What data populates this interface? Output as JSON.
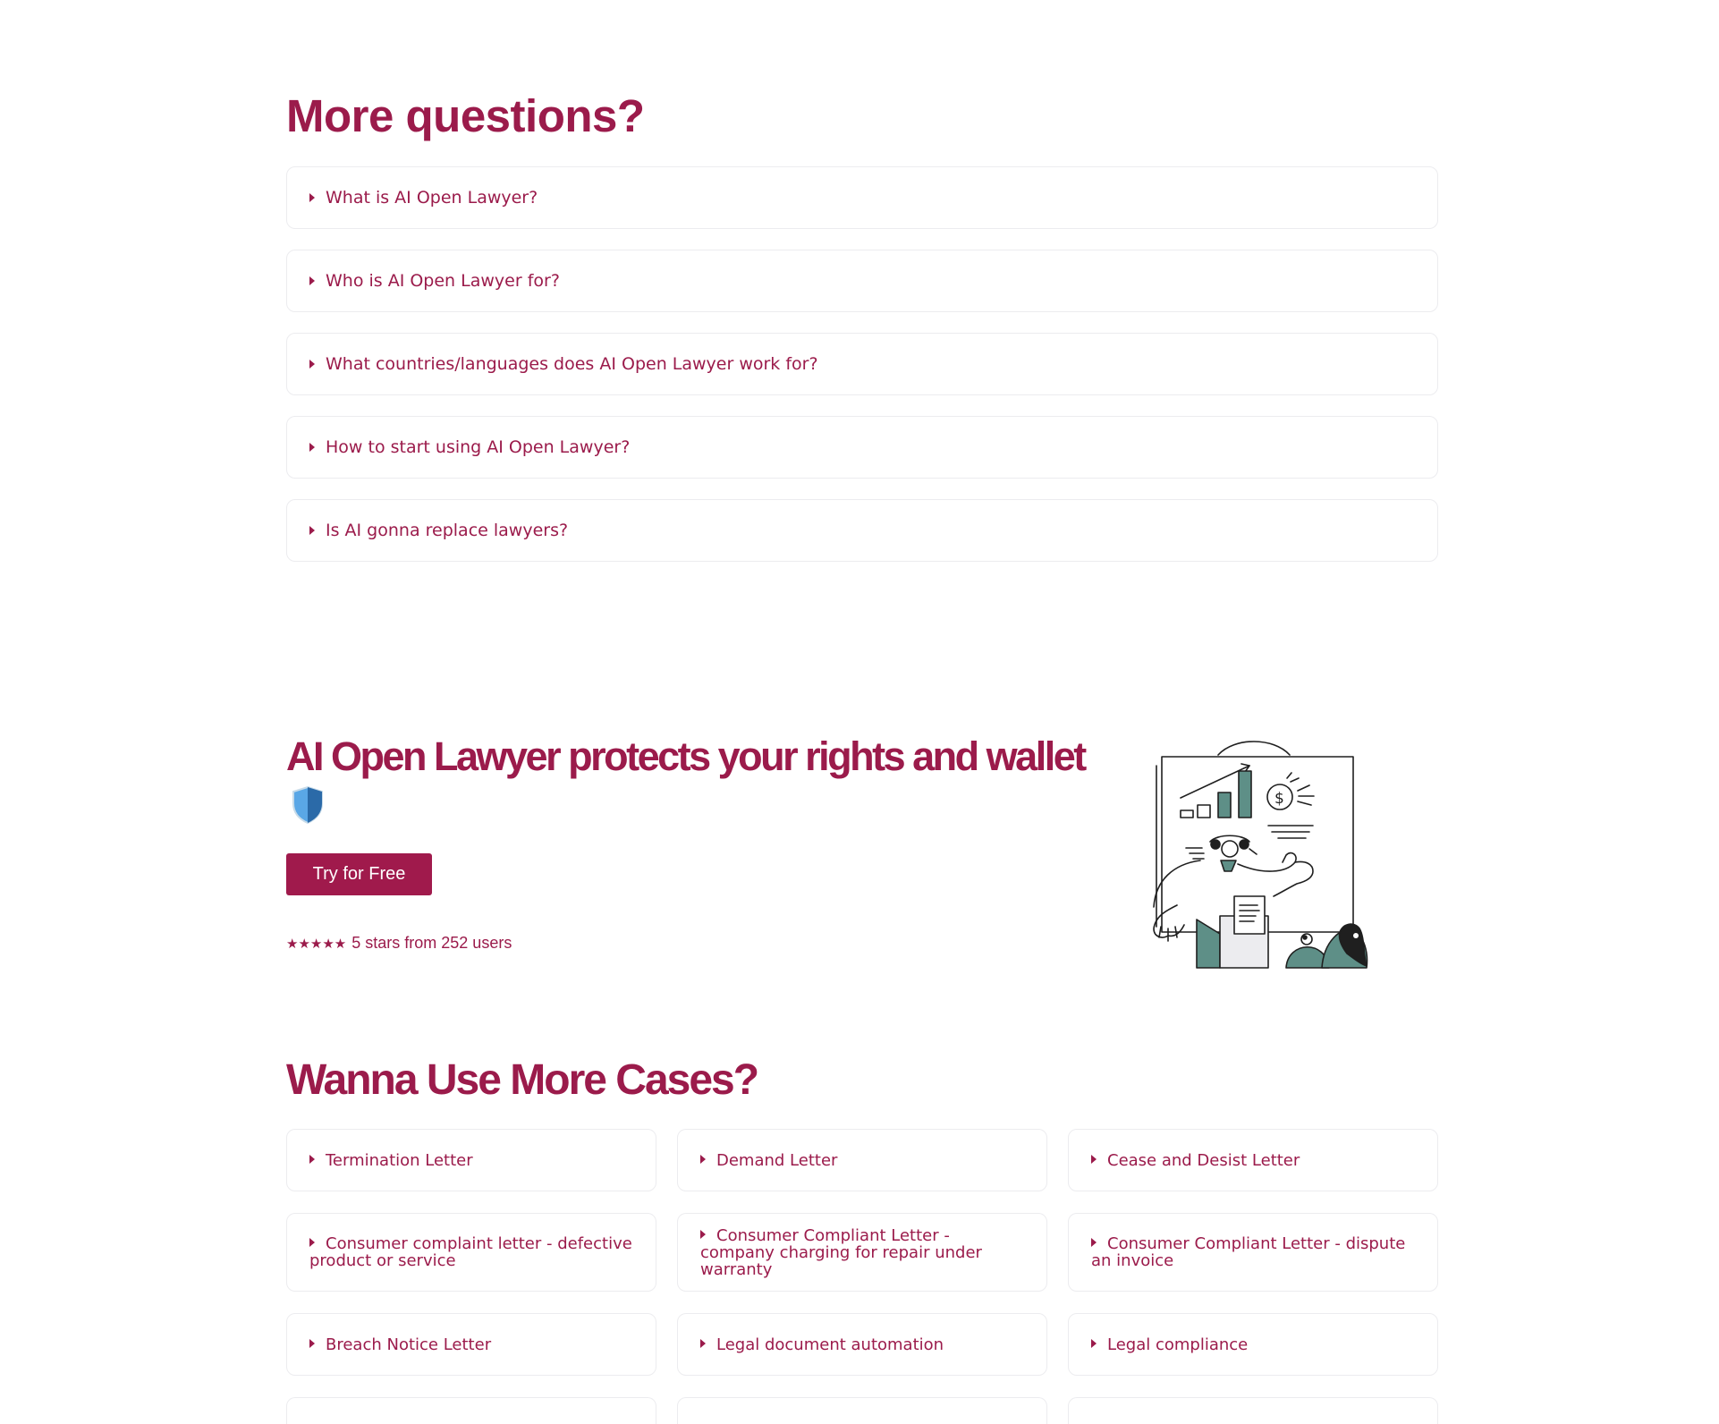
{
  "faq": {
    "title": "More questions?",
    "items": [
      "What is AI Open Lawyer?",
      "Who is AI Open Lawyer for?",
      "What countries/languages does AI Open Lawyer work for?",
      "How to start using AI Open Lawyer?",
      "Is AI gonna replace lawyers?"
    ]
  },
  "cta": {
    "title": "AI Open Lawyer protects your rights and wallet",
    "button": "Try for Free",
    "stars": "★★★★★",
    "rating_text": "5 stars from 252 users"
  },
  "cases": {
    "title": "Wanna Use More Cases?",
    "items": [
      "Termination Letter",
      "Demand Letter",
      "Cease and Desist Letter",
      "Consumer complaint letter - defective product or service",
      "Consumer Compliant Letter - company charging for repair under warranty",
      "Consumer Compliant Letter - dispute an invoice",
      "Breach Notice Letter",
      "Legal document automation",
      "Legal compliance"
    ]
  },
  "colors": {
    "brand": "#9b1b4b",
    "button_bg": "#a01a4c",
    "card_border": "#ececef",
    "illustration_accent": "#5e8f87"
  },
  "icons": [
    "caret-right-icon",
    "shield-icon",
    "presentation-illustration"
  ]
}
